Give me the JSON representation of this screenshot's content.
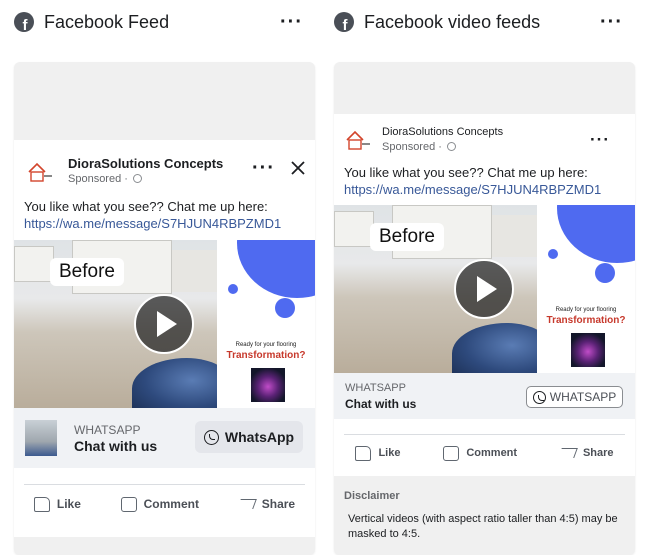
{
  "left_column": {
    "header_title": "Facebook Feed",
    "post": {
      "page_name": "DioraSolutions Concepts",
      "sponsored": "Sponsored",
      "text": "You like what you see?? Chat me up here:",
      "link": "https://wa.me/message/S7HJUN4RBPZMD1",
      "media": {
        "before_label": "Before",
        "promo_small": "Ready for your flooring",
        "promo_big": "Transformation?"
      },
      "cta": {
        "site": "WHATSAPP",
        "title": "Chat with us",
        "button": "WhatsApp"
      },
      "actions": {
        "like": "Like",
        "comment": "Comment",
        "share": "Share"
      }
    }
  },
  "right_column": {
    "header_title": "Facebook video feeds",
    "post": {
      "page_name": "DioraSolutions Concepts",
      "sponsored": "Sponsored",
      "text": "You like what you see?? Chat me up here:",
      "link": "https://wa.me/message/S7HJUN4RBPZMD1",
      "media": {
        "before_label": "Before",
        "promo_small": "Ready for your flooring",
        "promo_big": "Transformation?"
      },
      "cta": {
        "site": "WHATSAPP",
        "title": "Chat with us",
        "button": "WHATSAPP"
      },
      "actions": {
        "like": "Like",
        "comment": "Comment",
        "share": "Share"
      }
    },
    "disclaimer": {
      "title": "Disclaimer",
      "text": "Vertical videos (with aspect ratio taller than 4:5) may be masked to 4:5."
    }
  },
  "icons": [
    "facebook-icon",
    "more-options-icon",
    "close-icon",
    "globe-icon",
    "play-icon",
    "whatsapp-icon",
    "like-icon",
    "comment-icon",
    "share-icon"
  ],
  "colors": {
    "link": "#385898",
    "promo_accent": "#4f6af0",
    "promo_headline": "#c7392c"
  }
}
